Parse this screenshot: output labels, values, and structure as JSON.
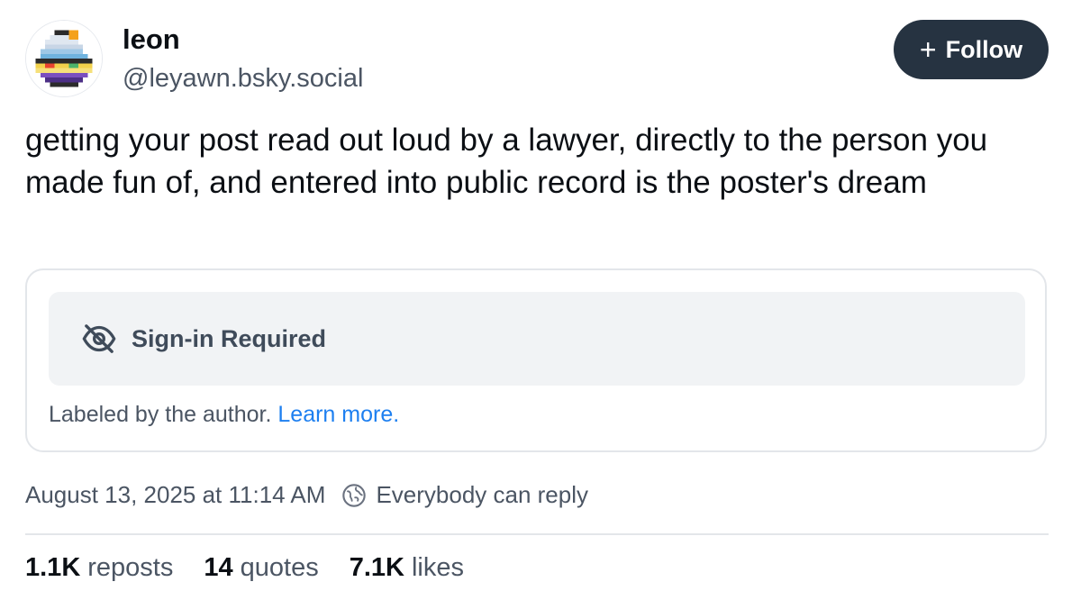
{
  "author": {
    "display_name": "leon",
    "handle": "@leyawn.bsky.social",
    "avatar_icon": "pixel-art-avatar"
  },
  "follow_button": {
    "icon": "plus-icon",
    "label": "Follow"
  },
  "post": {
    "text": "getting your post read out loud by a lawyer, directly to the person you made fun of, and entered into public record is the poster's dream"
  },
  "content_label": {
    "icon": "eye-off-icon",
    "warning": "Sign-in Required",
    "note": "Labeled by the author.",
    "learn_more": "Learn more."
  },
  "meta": {
    "timestamp": "August 13, 2025 at 11:14 AM",
    "reply_icon": "earth-icon",
    "reply_setting": "Everybody can reply"
  },
  "stats": {
    "reposts_count": "1.1K",
    "reposts_label": "reposts",
    "quotes_count": "14",
    "quotes_label": "quotes",
    "likes_count": "7.1K",
    "likes_label": "likes"
  },
  "colors": {
    "follow_bg": "#263341",
    "link": "#1d7ff0",
    "muted_text": "#4b5563",
    "warning_bg": "#f1f3f5"
  }
}
